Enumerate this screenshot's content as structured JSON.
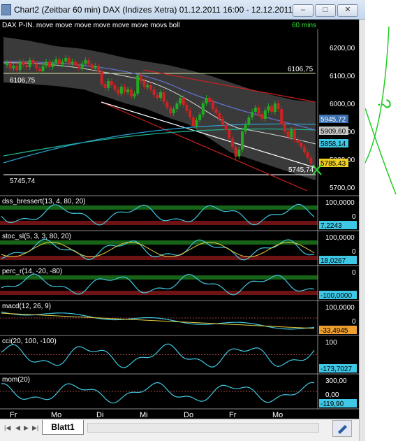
{
  "window": {
    "title": "Chart2 (Zeitbar 60 min)   DAX (Indizes Xetra) 01.12.2011 16:00 - 12.12.2011 1...",
    "minimize_label": "–",
    "maximize_label": "□",
    "close_label": "✕"
  },
  "main_panel": {
    "header": "DAX P-IN. move move move move move move movs boll",
    "timeframe": "60 mins",
    "price_axis": [
      "6200,00",
      "6100,00",
      "6000,00",
      "5900,00",
      "5800,00",
      "5700,00"
    ],
    "markers": {
      "top_right": "6106,75",
      "top_left": "6106,75",
      "bottom_left": "5745,74",
      "bottom_right": "5745,74"
    },
    "value_tags": [
      "5945,72",
      "5909,60",
      "5858,14",
      "5785,43"
    ]
  },
  "indicators": [
    {
      "label": "dss_bressert(13, 4, 80, 20)",
      "axis": [
        "100,0000",
        "0"
      ],
      "tag": "7,2243"
    },
    {
      "label": "stoc_sl(5, 3, 3, 80, 20)",
      "axis": [
        "100,0000",
        "0"
      ],
      "tag": "18,0267"
    },
    {
      "label": "perc_r(14, -20, -80)",
      "axis": [
        "0"
      ],
      "tag": "-100,0000"
    },
    {
      "label": "macd(12, 26, 9)",
      "axis": [
        "100,0000",
        "0"
      ],
      "tag": "-33,4945"
    },
    {
      "label": "cci(20, 100, -100)",
      "axis": [
        "100"
      ],
      "tag": "-173,7027"
    },
    {
      "label": "mom(20)",
      "axis": [
        "300,00",
        "0,00"
      ],
      "tag": "-119,90"
    }
  ],
  "time_axis": [
    "Fr",
    "Mo",
    "Di",
    "Mi",
    "Do",
    "Fr",
    "Mo"
  ],
  "sheet_tab": "Blatt1",
  "annotation": {
    "text": "?",
    "color": "#22cc22"
  },
  "colors": {
    "background": "#000000",
    "bollinger_band": "#3c3c3c",
    "candle_up": "#22aa22",
    "candle_down": "#cc2222",
    "green_zone": "#1a6e1a",
    "red_zone": "#7a1515",
    "tag_cyan": "#3ec8e6",
    "tag_yellow": "#f0d020",
    "tag_orange": "#f0a030"
  }
}
